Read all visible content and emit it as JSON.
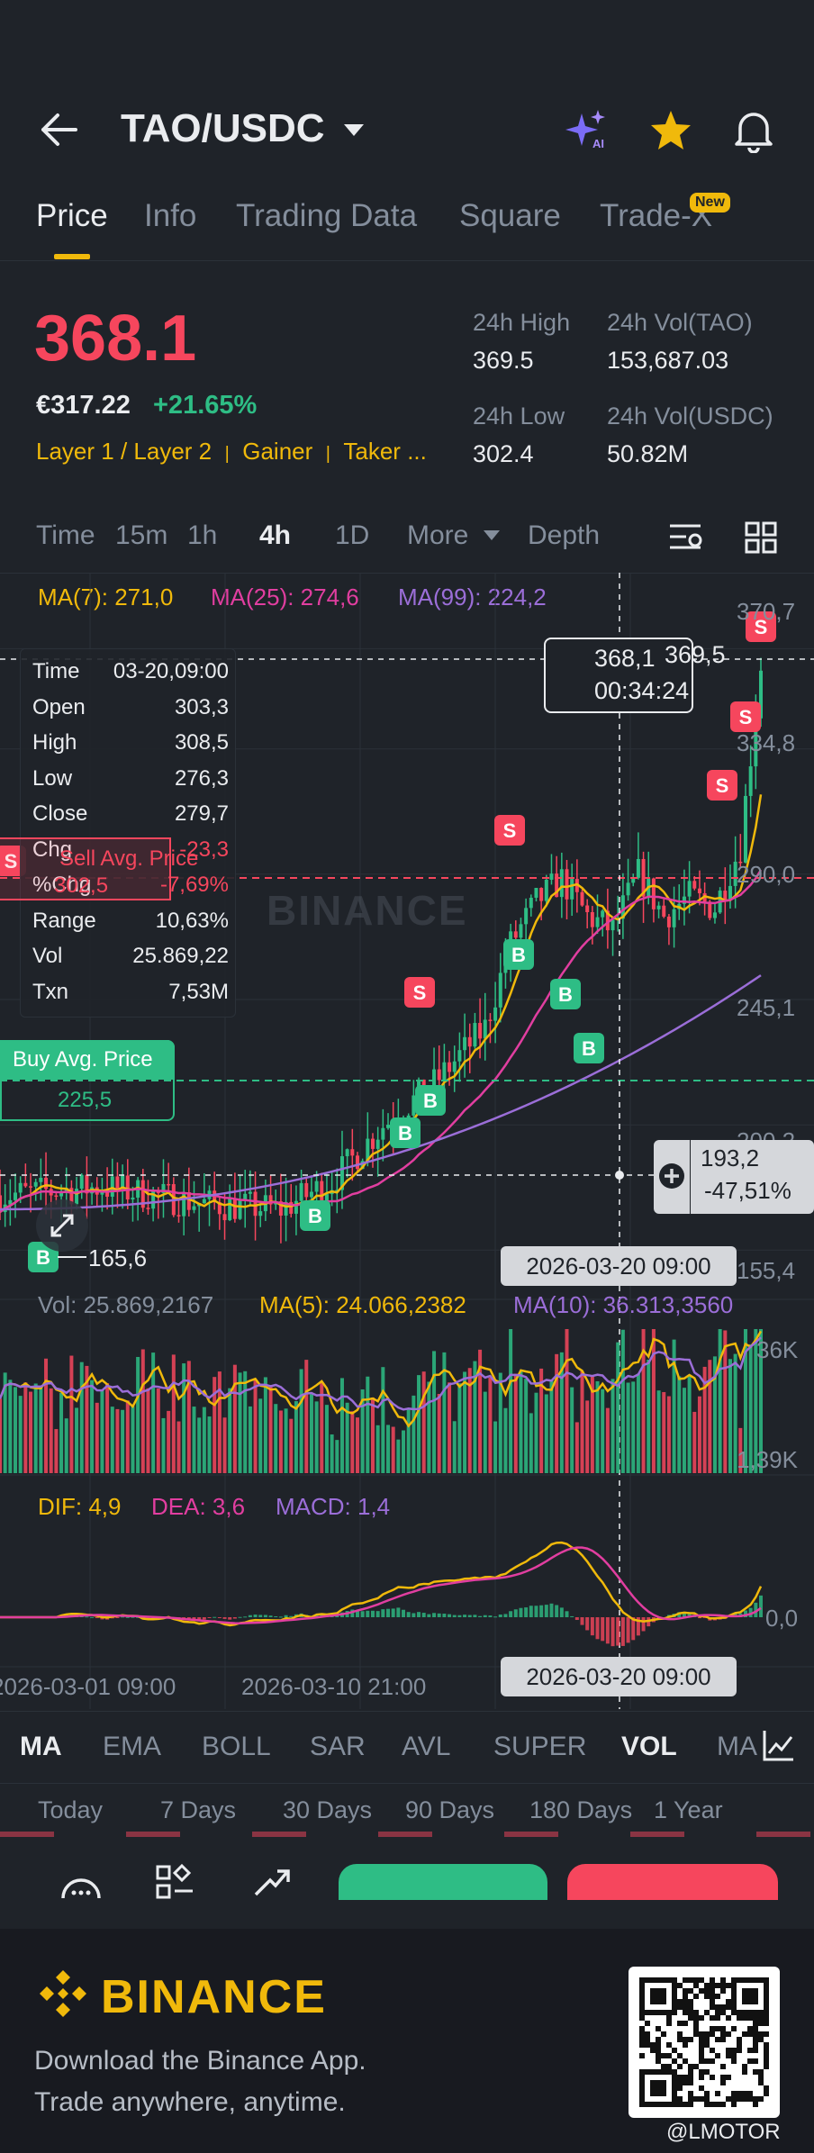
{
  "header": {
    "pair": "TAO/USDC"
  },
  "tabs": [
    "Price",
    "Info",
    "Trading Data",
    "Square",
    "Trade-X"
  ],
  "new_badge": "New",
  "ticker": {
    "last_price": "368.1",
    "fiat_price": "€317.22",
    "change_pct": "+21.65%",
    "tags": [
      "Layer 1 / Layer 2",
      "Gainer",
      "Taker ..."
    ],
    "high_label": "24h High",
    "high_value": "369.5",
    "vol_base_label": "24h Vol(TAO)",
    "vol_base_value": "153,687.03",
    "low_label": "24h Low",
    "low_value": "302.4",
    "vol_quote_label": "24h Vol(USDC)",
    "vol_quote_value": "50.82M"
  },
  "timeframes": [
    "Time",
    "15m",
    "1h",
    "4h",
    "1D",
    "More",
    "Depth"
  ],
  "ma_legend": {
    "ma7": "MA(7): 271,0",
    "ma25": "MA(25): 274,6",
    "ma99": "MA(99): 224,2"
  },
  "price_axis": [
    "370,7",
    "334,8",
    "290,0",
    "245,1",
    "200,2",
    "155,4"
  ],
  "current_tag": {
    "price": "368,1",
    "countdown": "00:34:24",
    "prev": "369,5"
  },
  "crosshair": {
    "value": "193,2",
    "pct": "-47,51%",
    "date": "2026-03-20 09:00"
  },
  "info_panel": [
    {
      "k": "Time",
      "v": "03-20,09:00"
    },
    {
      "k": "Open",
      "v": "303,3"
    },
    {
      "k": "High",
      "v": "308,5"
    },
    {
      "k": "Low",
      "v": "276,3"
    },
    {
      "k": "Close",
      "v": "279,7"
    },
    {
      "k": "Chg",
      "v": "-23,3"
    },
    {
      "k": "%Chg",
      "v": "-7,69%"
    },
    {
      "k": "Range",
      "v": "10,63%"
    },
    {
      "k": "Vol",
      "v": "25.869,22"
    },
    {
      "k": "Txn",
      "v": "7,53M"
    }
  ],
  "sell_avg_label": "Sell Avg. Price",
  "sell_avg_value": "302,5",
  "buy_avg_label": "Buy Avg. Price",
  "buy_avg_value": "225,5",
  "low_marker": "165,6",
  "watermark": "BINANCE",
  "volume": {
    "vol": "Vol: 25.869,2167",
    "ma5": "MA(5): 24.066,2382",
    "ma10": "MA(10): 36.313,3560",
    "top": "36K",
    "bottom": "1,39K"
  },
  "macd": {
    "dif": "DIF: 4,9",
    "dea": "DEA: 3,6",
    "macd": "MACD: 1,4",
    "zero": "0,0"
  },
  "x_axis": [
    "2026-03-01 09:00",
    "2026-03-10 21:00",
    "2026-03-20 09:00"
  ],
  "indicators": [
    "MA",
    "EMA",
    "BOLL",
    "SAR",
    "AVL",
    "SUPER",
    "VOL",
    "MA"
  ],
  "performance": [
    "Today",
    "7 Days",
    "30 Days",
    "90 Days",
    "180 Days",
    "1 Year"
  ],
  "footer": {
    "brand": "BINANCE",
    "line1": "Download the Binance App.",
    "line2": "Trade anywhere, anytime.",
    "credit": "@LMOTOR"
  },
  "colors": {
    "bg": "#1f2329",
    "red": "#f6465d",
    "green": "#2ebd85",
    "yellow": "#f0b90b",
    "pink": "#e13ea0",
    "purple": "#9b6ed8"
  },
  "chart_data": {
    "type": "candlestick",
    "y_axis_ticks": [
      370.7,
      334.8,
      290.0,
      245.1,
      200.2,
      155.4
    ],
    "ylim": [
      140,
      385
    ],
    "x_ticks": [
      "2026-03-01 09:00",
      "2026-03-10 21:00",
      "2026-03-20 09:00"
    ],
    "series": [
      {
        "name": "MA(7)",
        "color": "#f0b90b"
      },
      {
        "name": "MA(25)",
        "color": "#e13ea0"
      },
      {
        "name": "MA(99)",
        "color": "#9b6ed8"
      }
    ],
    "last_close": 368.1
  }
}
